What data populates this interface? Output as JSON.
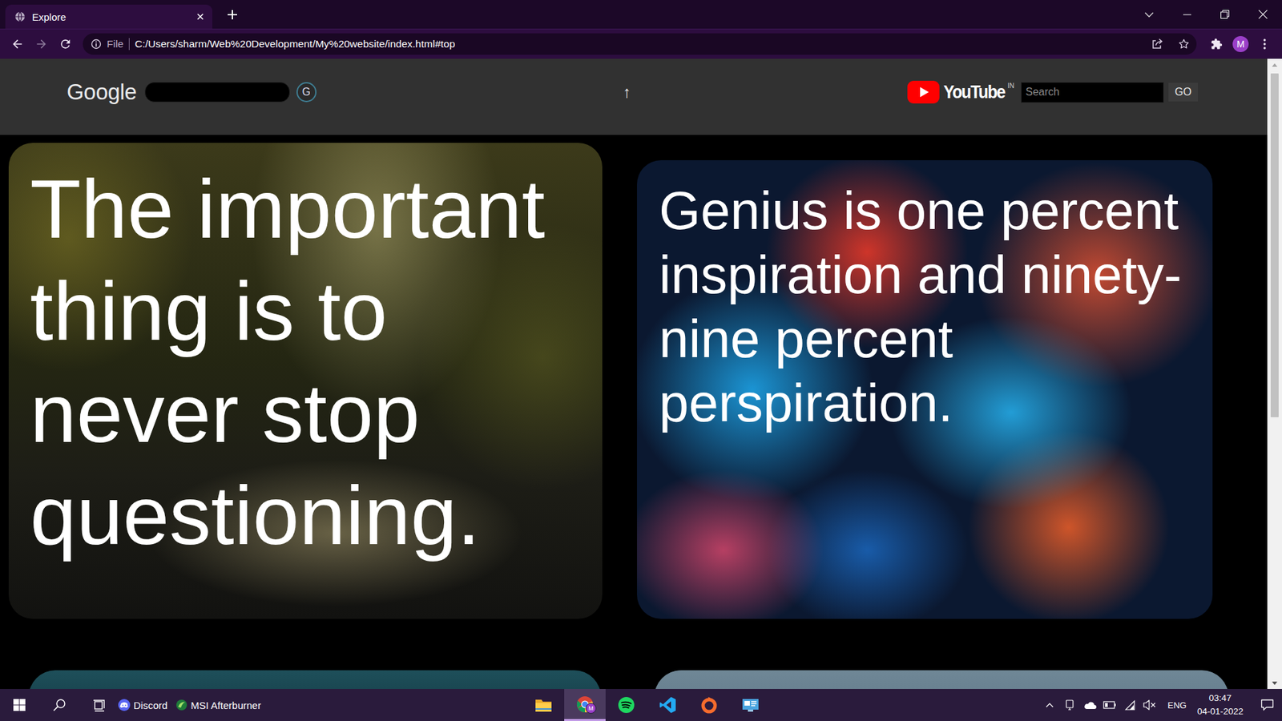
{
  "window": {
    "tab": {
      "label": "Explore",
      "selected": true
    }
  },
  "address_bar": {
    "scheme": "File",
    "url": "C:/Users/sharm/Web%20Development/My%20website/index.html#top"
  },
  "profile": {
    "initial": "M"
  },
  "page": {
    "header": {
      "google": {
        "label": "Google",
        "button": "G"
      },
      "scroll_top": "↑",
      "youtube": {
        "label": "YouTube",
        "region": "IN",
        "search_placeholder": "Search",
        "button": "GO"
      }
    },
    "cards": [
      {
        "quote": "The important thing is to never stop questioning."
      },
      {
        "quote": "Genius is one percent inspiration and ninety-nine percent perspiration."
      }
    ]
  },
  "taskbar": {
    "widgets": [
      {
        "label": "Discord",
        "kind": "discord"
      },
      {
        "label": "MSI Afterburner",
        "kind": "msi"
      }
    ],
    "apps": [
      {
        "kind": "explorer",
        "selected": false
      },
      {
        "kind": "chrome",
        "selected": true,
        "badge": "M"
      },
      {
        "kind": "spotify",
        "selected": false
      },
      {
        "kind": "vscode",
        "selected": false
      },
      {
        "kind": "origin",
        "selected": false
      },
      {
        "kind": "monitor",
        "selected": false
      }
    ],
    "tray": {
      "language": "ENG",
      "time": "03:47",
      "date": "04-01-2022",
      "muted": true
    }
  }
}
